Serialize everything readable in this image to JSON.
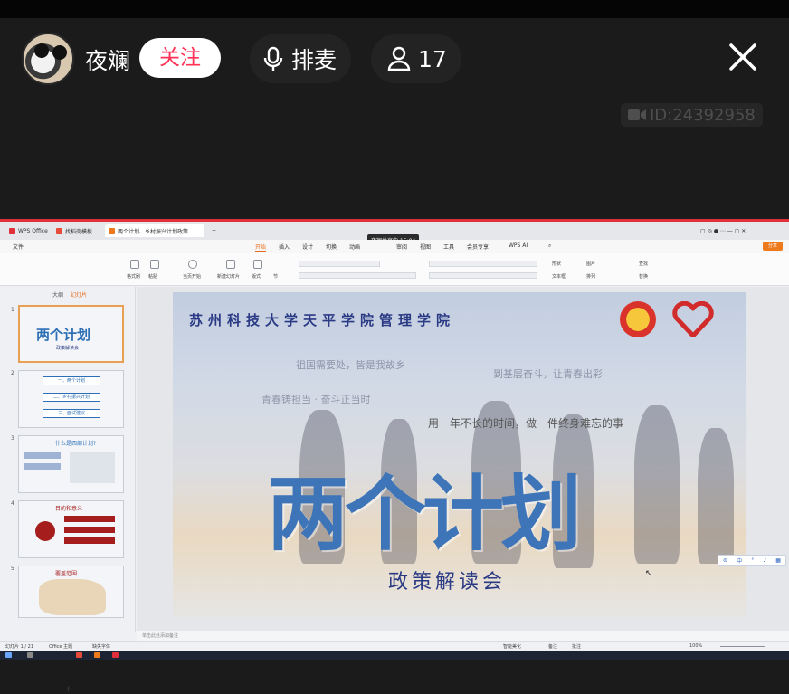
{
  "stream": {
    "host_name": "夜斓",
    "follow_label": "关注",
    "mic_label": "排麦",
    "audience_count": "17",
    "room_id": "ID:24392958"
  },
  "screen": {
    "tabs": [
      "WPS Office",
      "找稻壳模板",
      "两个计划、乡村振兴计划政策..."
    ],
    "tooltip": "夜斓共享中 15:04",
    "menus": [
      "文件",
      "开始",
      "插入",
      "设计",
      "切换",
      "动画",
      "放映",
      "审阅",
      "视图",
      "工具",
      "会员专享",
      "WPS AI"
    ],
    "active_menu": "开始",
    "share_button": "分享",
    "ribbon_labels": [
      "格式刷",
      "粘贴",
      "当页开始",
      "新建幻灯片",
      "版式",
      "节",
      "形状",
      "文本框",
      "排列",
      "图片",
      "查找",
      "替换"
    ],
    "side_tabs": {
      "outline": "大纲",
      "slides": "幻灯片"
    },
    "thumbnails": [
      {
        "num": "1",
        "title": "两个计划",
        "sub": "政策解读会"
      },
      {
        "num": "2",
        "items": [
          "一、两个计划",
          "二、乡村振兴计划",
          "三、面试建议"
        ]
      },
      {
        "num": "3",
        "heading": "什么是西部计划?"
      },
      {
        "num": "4",
        "heading": "目的和意义"
      },
      {
        "num": "5",
        "heading": "覆盖范围"
      }
    ],
    "slide": {
      "school": "苏州科技大学天平学院管理学院",
      "faint_1": "祖国需要处，皆是我故乡",
      "faint_2": "到基层奋斗，让青春出彩",
      "faint_3": "青春铸担当 · 奋斗正当时",
      "line": "用一年不长的时间，做一件终身难忘的事",
      "title": "两个计划",
      "subtitle": "政策解读会"
    },
    "notes_placeholder": "单击此处添加备注",
    "status": {
      "slide_counter": "幻灯片 1 / 21",
      "theme": "Office 主题",
      "font_missing": "缺失字体",
      "smart_beautify": "智能美化",
      "notes": "备注",
      "comments": "批注",
      "zoom": "100%"
    }
  }
}
